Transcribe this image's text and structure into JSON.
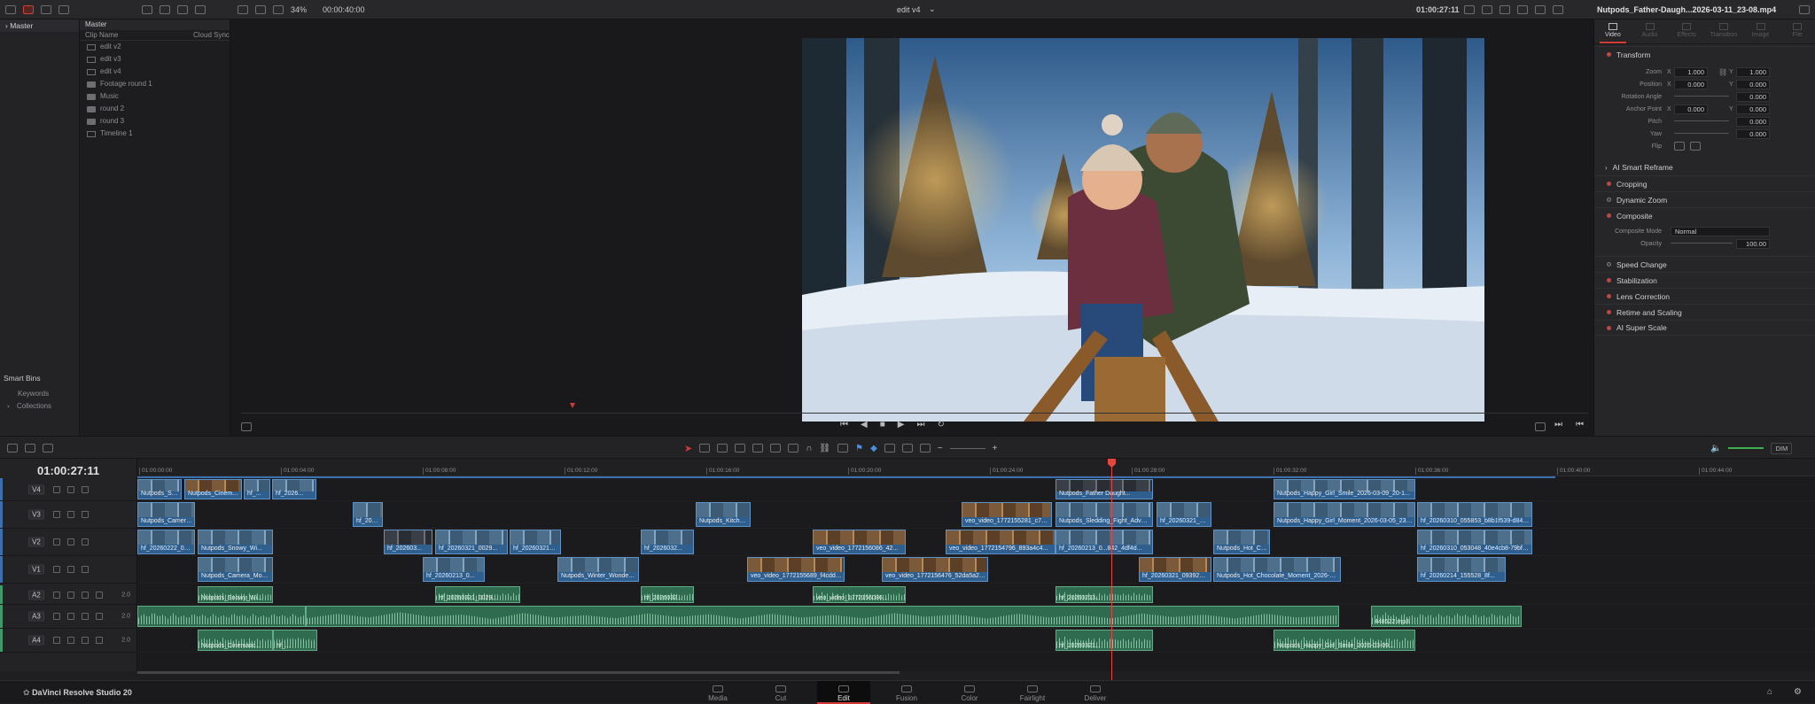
{
  "window_title": "edit v4",
  "topbar": {
    "zoom": "34%",
    "source_timecode": "00:00:40:00",
    "title": "edit v4",
    "record_timecode": "01:00:27:11",
    "clip_name": "Nutpods_Father-Daugh...2026-03-11_23-08.mp4"
  },
  "media_pool": {
    "root": "Master",
    "bin_header": "Master",
    "col_clip_name": "Clip Name",
    "col_cloud_sync": "Cloud Sync",
    "items": [
      {
        "label": "edit v2",
        "icon": "timeline-icon"
      },
      {
        "label": "edit v3",
        "icon": "timeline-icon"
      },
      {
        "label": "edit v4",
        "icon": "timeline-icon"
      },
      {
        "label": "Footage round 1",
        "icon": "folder-icon"
      },
      {
        "label": "Music",
        "icon": "folder-icon"
      },
      {
        "label": "round 2",
        "icon": "folder-icon"
      },
      {
        "label": "round 3",
        "icon": "folder-icon"
      },
      {
        "label": "Timeline 1",
        "icon": "timeline-icon"
      }
    ],
    "smart_bins": "Smart Bins",
    "keywords": "Keywords",
    "collections": "Collections"
  },
  "inspector": {
    "tabs": [
      "Video",
      "Audio",
      "Effects",
      "Transition",
      "Image",
      "File"
    ],
    "active_tab": "Video",
    "transform": {
      "title": "Transform",
      "zoom_label": "Zoom",
      "zoom_x": "1.000",
      "zoom_y": "1.000",
      "position_label": "Position",
      "position_x": "0.000",
      "position_y": "0.000",
      "rotation_label": "Rotation Angle",
      "rotation": "0.000",
      "anchor_label": "Anchor Point",
      "anchor_x": "0.000",
      "anchor_y": "0.000",
      "pitch_label": "Pitch",
      "pitch": "0.000",
      "yaw_label": "Yaw",
      "yaw": "0.000",
      "flip_label": "Flip",
      "x": "X",
      "y": "Y"
    },
    "ai_smart_reframe": "AI Smart Reframe",
    "cropping": "Cropping",
    "dynamic_zoom": "Dynamic Zoom",
    "composite": {
      "title": "Composite",
      "mode_label": "Composite Mode",
      "mode": "Normal",
      "opacity_label": "Opacity",
      "opacity": "100.00"
    },
    "speed_change": "Speed Change",
    "stabilization": "Stabilization",
    "lens_correction": "Lens Correction",
    "retime_scaling": "Retime and Scaling",
    "ai_super_scale": "AI Super Scale"
  },
  "timeline": {
    "timecode": "01:00:27:11",
    "dim_label": "DIM",
    "ruler": [
      "01:00:00:00",
      "01:00:04:00",
      "01:00:08:00",
      "01:00:12:00",
      "01:00:16:00",
      "01:00:20:00",
      "01:00:24:00",
      "01:00:28:00",
      "01:00:32:00",
      "01:00:36:00",
      "01:00:40:00",
      "01:00:44:00"
    ],
    "tracks": [
      {
        "name": "V4",
        "type": "video"
      },
      {
        "name": "V3",
        "type": "video"
      },
      {
        "name": "V2",
        "type": "video"
      },
      {
        "name": "V1",
        "type": "video"
      },
      {
        "name": "A2",
        "type": "audio",
        "vol": "2.0"
      },
      {
        "name": "A3",
        "type": "audio",
        "vol": "2.0"
      },
      {
        "name": "A4",
        "type": "audio",
        "vol": "2.0"
      }
    ],
    "clips": {
      "V4": [
        "Nutpods_Stock_201...",
        "Nutpods_Cinematic...",
        "hf_...",
        "hf_2026...",
        "Nutpods_Father Daught...",
        "Nutpods_Happy_Girl_Smile_2026-03-09_20-1..."
      ],
      "V3": [
        "Nutpods_Camera_...",
        "hf_2026...",
        "Nutpods_Kitchen...",
        "veo_video_1772155281_c759f...",
        "Nutpods_Sledding_Fight_Advent...",
        "hf_20260321_094...",
        "Nutpods_Happy_Girl_Moment_2026-03-05_23-47...",
        "hf_20260310_055853_b8b1f539-d847-4..."
      ],
      "V2": [
        "hf_20260222_0158...",
        "Nutpods_Snowy_Wi...",
        "hf_202603...",
        "hf_20260321_0029...",
        "hf_20260321_0...",
        "hf_2026032...",
        "veo_video_1772156086_42...",
        "veo_video_1772154796_893a4c4...",
        "hf_20260213_0...842_4df4d...",
        "Nutpods_Hot_Cho...",
        "hf_20260310_053048_40e4cb8-79bf-4..."
      ],
      "V1": [
        "Nutpods_Camera_Move...",
        "hf_20260213_0...",
        "Nutpods_Winter_Wonderla...",
        "veo_video_1772155689_f4cddd...",
        "veo_video_1772156476_52da5a2eba...",
        "hf_20260321_093920_4...",
        "Nutpods_Hot_Chocolate_Moment_2026-03...",
        "hf_20260214_155528_8f..."
      ],
      "A2": [
        "Nutpods_Snowy_Wi...",
        "hf_20260321_0029...",
        "hf_2026032...",
        "veo_video_1772156086...",
        "hf_20260213..."
      ],
      "A3": [
        "",
        "448522.mp3"
      ],
      "A4": [
        "Nutpods_Cinematic...",
        "hf_...",
        "hf_20260321...",
        "Nutpods_Happy_Girl_Smile_2026-03-09..."
      ]
    }
  },
  "pages": [
    "Media",
    "Cut",
    "Edit",
    "Fusion",
    "Color",
    "Fairlight",
    "Deliver"
  ],
  "active_page": "Edit",
  "app_name": "DaVinci Resolve Studio 20",
  "colors": {
    "accent_red": "#d23b36",
    "video_clip": "#2f5f8f",
    "audio_clip": "#2f6b4f",
    "playhead": "#e2473f"
  }
}
